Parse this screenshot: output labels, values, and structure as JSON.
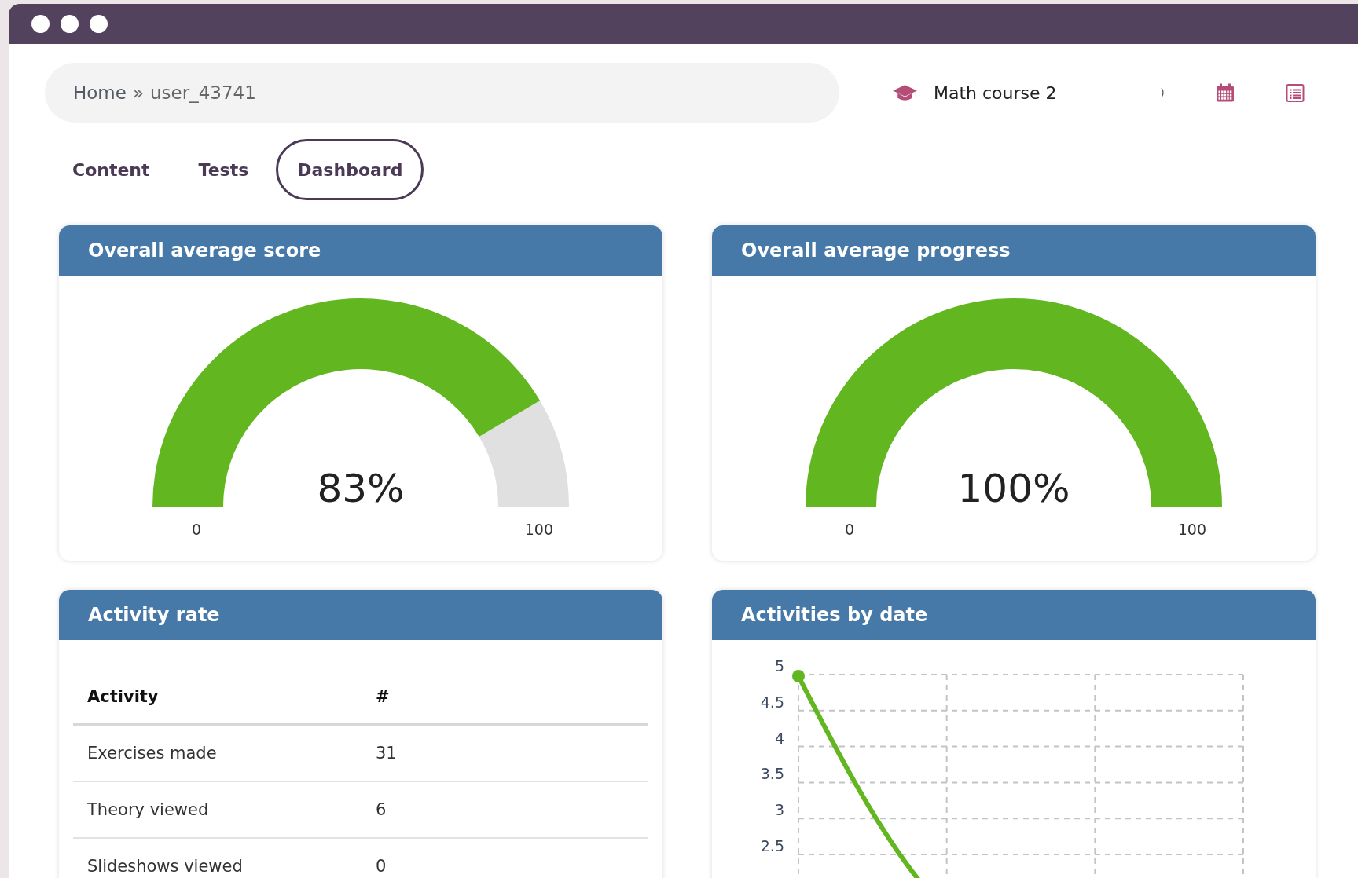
{
  "breadcrumb": {
    "items": [
      "Home",
      "user_43741"
    ],
    "separator": "»"
  },
  "course": {
    "name": "Math course 2"
  },
  "tabs": [
    {
      "label": "Content",
      "selected": false
    },
    {
      "label": "Tests",
      "selected": false
    },
    {
      "label": "Dashboard",
      "selected": true
    }
  ],
  "gauges": [
    {
      "title": "Overall average score",
      "value": "83%",
      "min": "0",
      "max": "100"
    },
    {
      "title": "Overall average progress",
      "value": "100%",
      "min": "0",
      "max": "100"
    }
  ],
  "activity_rate": {
    "title": "Activity rate",
    "columns": [
      "Activity",
      "#"
    ],
    "rows": [
      [
        "Exercises made",
        "31"
      ],
      [
        "Theory viewed",
        "6"
      ],
      [
        "Slideshows viewed",
        "0"
      ]
    ]
  },
  "activities_by_date": {
    "title": "Activities by date",
    "y_axis_labels": [
      "5",
      "4.5",
      "4",
      "3.5",
      "3",
      "2.5"
    ]
  }
}
